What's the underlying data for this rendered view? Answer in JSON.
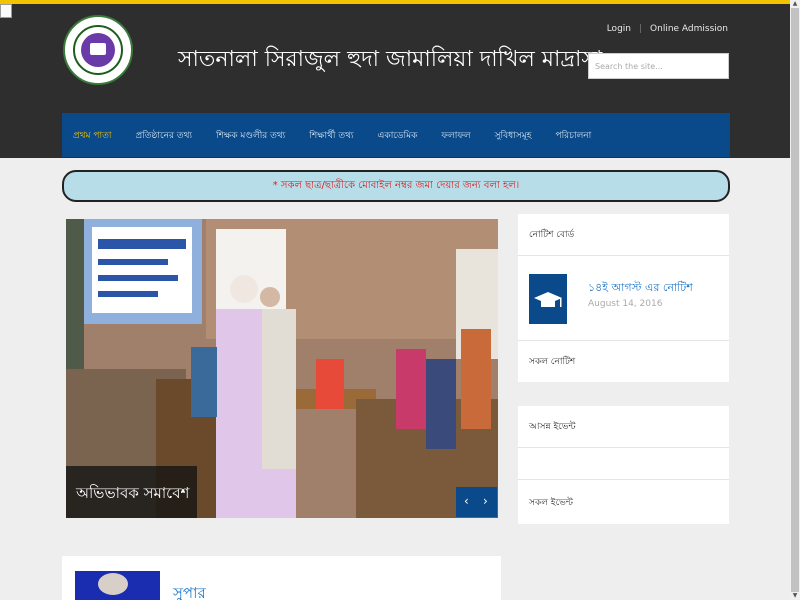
{
  "header": {
    "title": "সাতনালা সিরাজুল হুদা জামালিয়া দাখিল মাদ্রাসা",
    "login": "Login",
    "online_admission": "Online Admission",
    "search_placeholder": "Search the site..."
  },
  "nav": {
    "items": [
      "প্রথম পাতা",
      "প্রতিষ্ঠানের তথ্য",
      "শিক্ষক মণ্ডলীর তথ্য",
      "শিক্ষার্থী তথ্য",
      "একাডেমিক",
      "ফলাফল",
      "সুবিধাসমূহ",
      "পরিচালনা"
    ]
  },
  "notice_bar": "* সকল ছাত্র/ছাত্রীকে মোবাইল নম্বর জমা দেয়ার জন্য বলা হল।",
  "slider": {
    "caption": "অভিভাবক সমাবেশ",
    "prev": "‹",
    "next": "›"
  },
  "notice_panel": {
    "heading": "নোটিশ বোর্ড",
    "item_title": "১৪ই আগস্ট এর নোটিশ",
    "item_date": "August 14, 2016",
    "all_link": "সকল নোটিশ"
  },
  "event_panel": {
    "heading": "আসন্ন ইভেন্ট",
    "all_link": "সকল ইভেন্ট"
  },
  "bottom": {
    "title": "সুপার"
  },
  "colors": {
    "header_bg": "#2e2e2e",
    "nav_bg": "#0a4a8a",
    "accent": "#f5c400",
    "notice_bg": "#b7dde9",
    "notice_text": "#d91c1c",
    "link": "#1a73c9"
  }
}
